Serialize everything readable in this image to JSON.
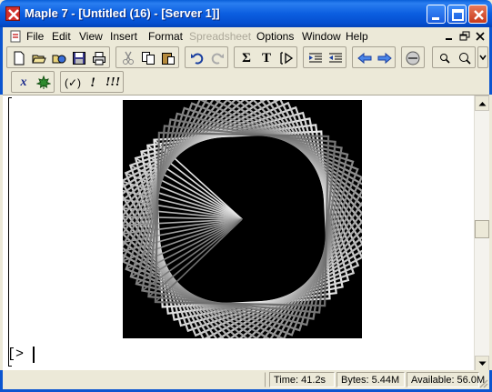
{
  "window": {
    "title": "Maple 7  - [Untitled (16) - [Server 1]]",
    "controls": [
      "minimize-icon",
      "maximize-icon",
      "close-icon"
    ]
  },
  "menubar": {
    "items": [
      {
        "label": "File",
        "enabled": true
      },
      {
        "label": "Edit",
        "enabled": true
      },
      {
        "label": "View",
        "enabled": true
      },
      {
        "label": "Insert",
        "enabled": true
      },
      {
        "label": "Format",
        "enabled": true
      },
      {
        "label": "Spreadsheet",
        "enabled": false
      },
      {
        "label": "Options",
        "enabled": true
      },
      {
        "label": "Window",
        "enabled": true
      },
      {
        "label": "Help",
        "enabled": true
      }
    ]
  },
  "toolbar": {
    "icons": [
      "new-file-icon",
      "open-file-icon",
      "open-url-icon",
      "save-icon",
      "print-icon",
      "cut-icon",
      "copy-icon",
      "paste-icon",
      "undo-icon",
      "redo-icon",
      "sum-icon",
      "text-icon",
      "prompt-icon",
      "indent-icon",
      "outdent-icon",
      "back-icon",
      "forward-icon",
      "stop-icon",
      "zoom-in-icon",
      "zoom-out-icon"
    ],
    "text_label": "T",
    "sum_label": "Σ",
    "prompt_label": "[>"
  },
  "context_toolbar": {
    "x_label": "x",
    "check_label": "(✓)",
    "exec_label": "!",
    "exec_all_label": "!!!"
  },
  "worksheet": {
    "prompt_text": "[>",
    "plot": {
      "background": "#000000",
      "figure": "rotating squares"
    }
  },
  "statusbar": {
    "time": "Time:  41.2s",
    "bytes": "Bytes: 5.44M",
    "available": "Available: 56.0M"
  },
  "colors": {
    "titlebar": "#0b5ee0",
    "chrome": "#ece9d8",
    "disabled_text": "#aca899"
  }
}
